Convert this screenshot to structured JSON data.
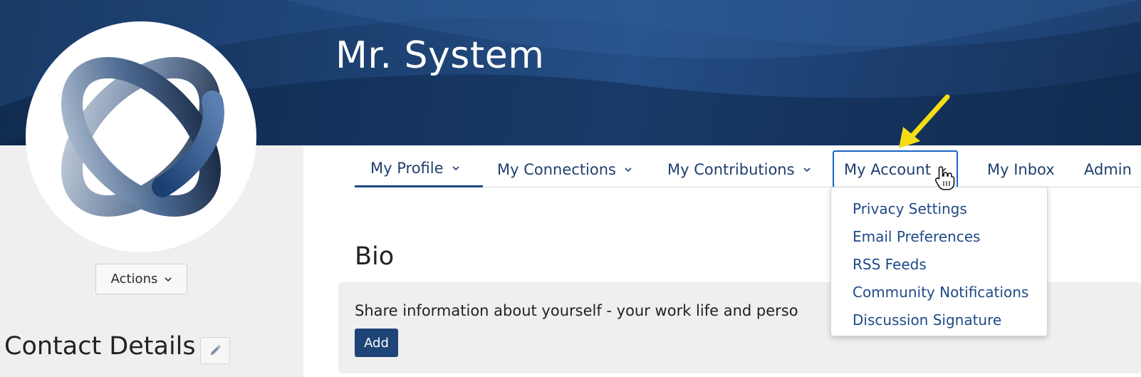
{
  "header": {
    "profile_name": "Mr. System"
  },
  "sidebar": {
    "actions_label": "Actions",
    "contact_title": "Contact Details"
  },
  "tabs": [
    {
      "label": "My Profile",
      "has_dropdown": true,
      "active": true
    },
    {
      "label": "My Connections",
      "has_dropdown": true
    },
    {
      "label": "My Contributions",
      "has_dropdown": true
    },
    {
      "label": "My Account",
      "has_dropdown": true,
      "focused": true
    },
    {
      "label": "My Inbox",
      "has_dropdown": false
    },
    {
      "label": "Admin",
      "has_dropdown": false
    }
  ],
  "account_menu": {
    "items": [
      {
        "label": "Privacy Settings"
      },
      {
        "label": "Email Preferences"
      },
      {
        "label": "RSS Feeds"
      },
      {
        "label": "Community Notifications"
      },
      {
        "label": "Discussion Signature"
      }
    ]
  },
  "bio": {
    "title": "Bio",
    "prompt": "Share information about yourself - your work life and perso",
    "add_label": "Add"
  },
  "colors": {
    "banner_dark": "#0f2a4d",
    "link_blue": "#1f4a86",
    "button_blue": "#1f4477",
    "focus_blue": "#1a63c9",
    "annotation_yellow": "#f5dd14"
  },
  "icons": {
    "avatar": "rings-logo-icon",
    "edit": "pencil-icon",
    "dropdown": "chevron-down-icon",
    "annotation": "yellow-arrow-icon",
    "cursor": "hand-pointer-icon"
  }
}
